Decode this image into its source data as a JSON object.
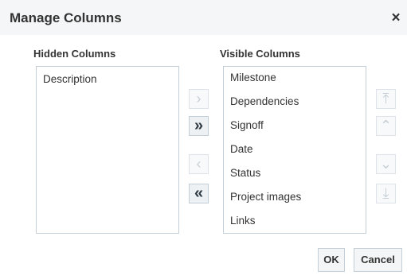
{
  "dialog": {
    "title": "Manage Columns",
    "close_glyph": "×"
  },
  "hidden_columns": {
    "header": "Hidden Columns",
    "items": [
      "Description"
    ]
  },
  "visible_columns": {
    "header": "Visible Columns",
    "items": [
      "Milestone",
      "Dependencies",
      "Signoff",
      "Date",
      "Status",
      "Project images",
      "Links"
    ]
  },
  "transfer_buttons": {
    "move_selected_right": "›",
    "move_all_right": "»",
    "move_selected_left": "‹",
    "move_all_left": "«"
  },
  "reorder_buttons": {
    "move_top": "⤒",
    "move_up": "⌃",
    "move_down": "⌄",
    "move_bottom": "⤓"
  },
  "footer": {
    "ok_label": "OK",
    "cancel_label": "Cancel"
  },
  "colors": {
    "title_bar_bg": "#f5f6f7",
    "border": "#c4ced7",
    "text": "#333333",
    "disabled_glyph": "#c7cfd6"
  }
}
